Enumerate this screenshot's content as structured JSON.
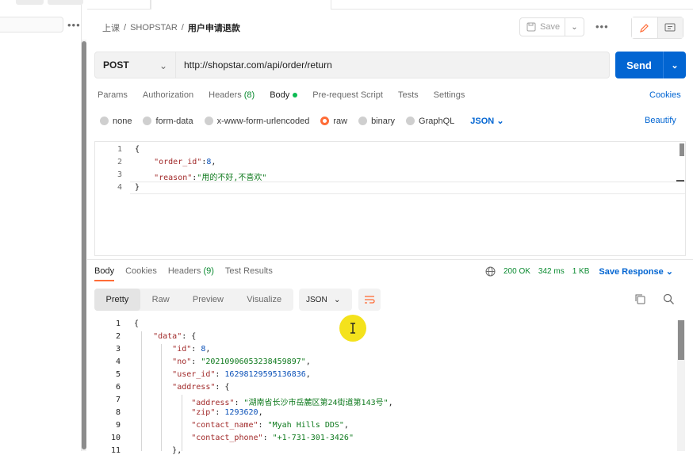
{
  "breadcrumb": {
    "part1": "上课",
    "sep": "/",
    "part2": "SHOPSTAR",
    "current": "用户申请退款"
  },
  "toolbar": {
    "save_label": "Save",
    "more": "•••"
  },
  "request": {
    "method": "POST",
    "url": "http://shopstar.com/api/order/return",
    "send_label": "Send"
  },
  "req_tabs": {
    "params": "Params",
    "authorization": "Authorization",
    "headers": "Headers",
    "headers_count": "(8)",
    "body": "Body",
    "pre_request": "Pre-request Script",
    "tests": "Tests",
    "settings": "Settings",
    "cookies": "Cookies"
  },
  "body_types": {
    "none": "none",
    "form_data": "form-data",
    "urlencoded": "x-www-form-urlencoded",
    "raw": "raw",
    "binary": "binary",
    "graphql": "GraphQL",
    "lang": "JSON",
    "beautify": "Beautify"
  },
  "request_body": {
    "line_numbers": [
      "1",
      "2",
      "3",
      "4"
    ],
    "l1": "{",
    "l2_key": "\"order_id\"",
    "l2_val": "8",
    "l3_key": "\"reason\"",
    "l3_val": "\"用的不好,不喜欢\"",
    "l4": "}"
  },
  "resp_tabs": {
    "body": "Body",
    "cookies": "Cookies",
    "headers": "Headers",
    "headers_count": "(9)",
    "test_results": "Test Results"
  },
  "status": {
    "code": "200 OK",
    "time": "342 ms",
    "size": "1 KB",
    "save_response": "Save Response"
  },
  "format": {
    "pretty": "Pretty",
    "raw": "Raw",
    "preview": "Preview",
    "visualize": "Visualize",
    "lang": "JSON"
  },
  "response_body": {
    "line_numbers": [
      "1",
      "2",
      "3",
      "4",
      "5",
      "6",
      "7",
      "8",
      "9",
      "10",
      "11"
    ],
    "l1": "{",
    "l2_key": "\"data\"",
    "l3_key": "\"id\"",
    "l3_val": "8",
    "l4_key": "\"no\"",
    "l4_val": "\"20210906053238459897\"",
    "l5_key": "\"user_id\"",
    "l5_val": "16298129595136836",
    "l6_key": "\"address\"",
    "l7_key": "\"address\"",
    "l7_val": "\"湖南省长沙市岳麓区第24街道第143号\"",
    "l8_key": "\"zip\"",
    "l8_val": "1293620",
    "l9_key": "\"contact_name\"",
    "l9_val": "\"Myah Hills DDS\"",
    "l10_key": "\"contact_phone\"",
    "l10_val": "\"+1-731-301-3426\"",
    "l11": "},"
  },
  "colors": {
    "accent": "#ff6c37",
    "primary": "#0265d2",
    "success": "#0a8a30"
  }
}
